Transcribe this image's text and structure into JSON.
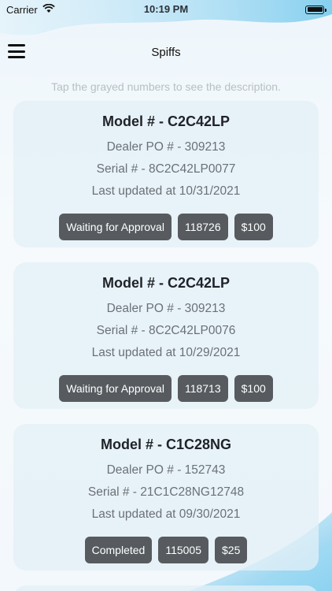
{
  "status_bar": {
    "carrier": "Carrier",
    "time": "10:19 PM"
  },
  "nav": {
    "title": "Spiffs"
  },
  "hint": "Tap the grayed numbers to see the description.",
  "cards": [
    {
      "model": "Model # - C2C42LP",
      "dealer_po": "Dealer PO # - 309213",
      "serial": "Serial # - 8C2C42LP0077",
      "updated": "Last updated at 10/31/2021",
      "status": "Waiting for Approval",
      "number": "118726",
      "amount": "$100"
    },
    {
      "model": "Model # - C2C42LP",
      "dealer_po": "Dealer PO # - 309213",
      "serial": "Serial # - 8C2C42LP0076",
      "updated": "Last updated at 10/29/2021",
      "status": "Waiting for Approval",
      "number": "118713",
      "amount": "$100"
    },
    {
      "model": "Model # - C1C28NG",
      "dealer_po": "Dealer PO # - 152743",
      "serial": "Serial # - 21C1C28NG12748",
      "updated": "Last updated at 09/30/2021",
      "status": "Completed",
      "number": "115005",
      "amount": "$25"
    }
  ],
  "colors": {
    "chip_bg": "#575b5f",
    "card_bg": "#e3f0f7",
    "accent_wave": "#6cc6ec"
  }
}
